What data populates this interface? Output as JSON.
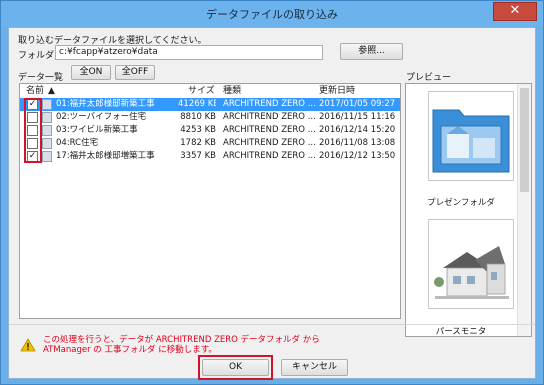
{
  "window": {
    "title": "データファイルの取り込み",
    "close_glyph": "✕"
  },
  "instruction": "取り込むデータファイルを選択してください。",
  "folder": {
    "label": "フォルダ",
    "value": "c:¥fcapp¥atzero¥data",
    "browse_label": "参照..."
  },
  "list": {
    "label": "データ一覧",
    "all_on_label": "全ON",
    "all_off_label": "全OFF",
    "columns": {
      "name": "名前",
      "sort": "▲",
      "size": "サイズ",
      "type": "種類",
      "updated": "更新日時"
    },
    "rows": [
      {
        "checked": "✓",
        "name": "01:福井太郎様邸新築工事",
        "size": "41269 KB",
        "type": "ARCHITREND ZERO ...",
        "updated": "2017/01/05 09:27"
      },
      {
        "checked": "",
        "name": "02:ツーバイフォー住宅",
        "size": "8810 KB",
        "type": "ARCHITREND ZERO ...",
        "updated": "2016/11/15 11:16"
      },
      {
        "checked": "",
        "name": "03:ワイビル新築工事",
        "size": "4253 KB",
        "type": "ARCHITREND ZERO ...",
        "updated": "2016/12/14 15:20"
      },
      {
        "checked": "",
        "name": "04:RC住宅",
        "size": "1782 KB",
        "type": "ARCHITREND ZERO ...",
        "updated": "2016/11/08 13:08"
      },
      {
        "checked": "✓",
        "name": "17:福井太郎様邸増築工事",
        "size": "3357 KB",
        "type": "ARCHITREND ZERO ...",
        "updated": "2016/12/12 13:50"
      }
    ]
  },
  "preview": {
    "label": "プレビュー",
    "items": [
      {
        "caption": "プレゼンフォルダ"
      },
      {
        "caption": "パースモニタ"
      }
    ]
  },
  "warning": {
    "icon": "warning-icon",
    "line1": "この処理を行うと、データが ARCHITREND ZERO データフォルダ から",
    "line2": "ATManager の 工事フォルダ に移動します。"
  },
  "buttons": {
    "ok": "OK",
    "cancel": "キャンセル"
  },
  "colors": {
    "selection": "#3399ff",
    "highlight_box": "#d0142c",
    "warning_text": "#e0001b"
  }
}
